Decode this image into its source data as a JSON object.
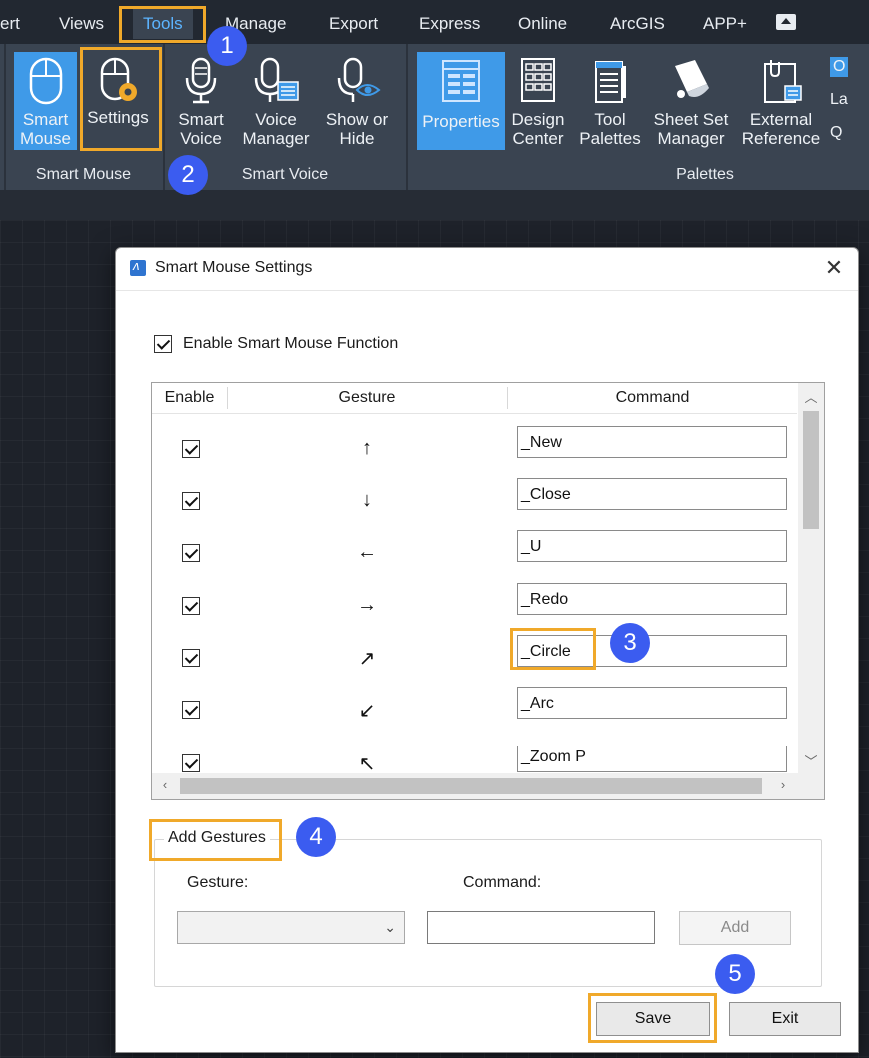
{
  "menubar": {
    "items": [
      "ert",
      "Views",
      "Tools",
      "Manage",
      "Export",
      "Express",
      "Online",
      "ArcGIS",
      "APP+"
    ],
    "active": "Tools"
  },
  "ribbon": {
    "groups": [
      "Smart Mouse",
      "Smart Voice",
      "Palettes"
    ],
    "buttons": {
      "smart_mouse": [
        "Smart",
        "Mouse"
      ],
      "settings": "Settings",
      "smart_voice": [
        "Smart",
        "Voice"
      ],
      "voice_manager": [
        "Voice",
        "Manager"
      ],
      "show_hide": [
        "Show or",
        "Hide"
      ],
      "properties": "Properties",
      "design_center": [
        "Design",
        "Center"
      ],
      "tool_palettes": [
        "Tool",
        "Palettes"
      ],
      "sheet_set": [
        "Sheet Set",
        "Manager"
      ],
      "external_ref": [
        "External",
        "Reference"
      ]
    },
    "mini_labels": [
      "O",
      "La",
      "Q"
    ]
  },
  "callouts": [
    "1",
    "2",
    "3",
    "4",
    "5"
  ],
  "dialog": {
    "title": "Smart Mouse Settings",
    "enable_label": "Enable Smart Mouse Function",
    "enable_checked": true,
    "columns": [
      "Enable",
      "Gesture",
      "Command"
    ],
    "rows": [
      {
        "enabled": true,
        "gesture": "↑",
        "command": "_New"
      },
      {
        "enabled": true,
        "gesture": "↓",
        "command": "_Close"
      },
      {
        "enabled": true,
        "gesture": "←",
        "command": "_U"
      },
      {
        "enabled": true,
        "gesture": "→",
        "command": "_Redo"
      },
      {
        "enabled": true,
        "gesture": "↗",
        "command": "_Circle"
      },
      {
        "enabled": true,
        "gesture": "↙",
        "command": "_Arc"
      },
      {
        "enabled": true,
        "gesture": "↖",
        "command": "_Zoom P"
      }
    ],
    "add_gestures": {
      "legend": "Add Gestures",
      "gesture_label": "Gesture:",
      "command_label": "Command:",
      "gesture_value": "",
      "command_value": "",
      "add_label": "Add"
    },
    "save_label": "Save",
    "exit_label": "Exit"
  },
  "colors": {
    "accent_blue": "#3f9ae8",
    "callout_orange": "#f0a92a",
    "badge_blue": "#3b5cf0",
    "ribbon_bg": "#3a4451"
  }
}
